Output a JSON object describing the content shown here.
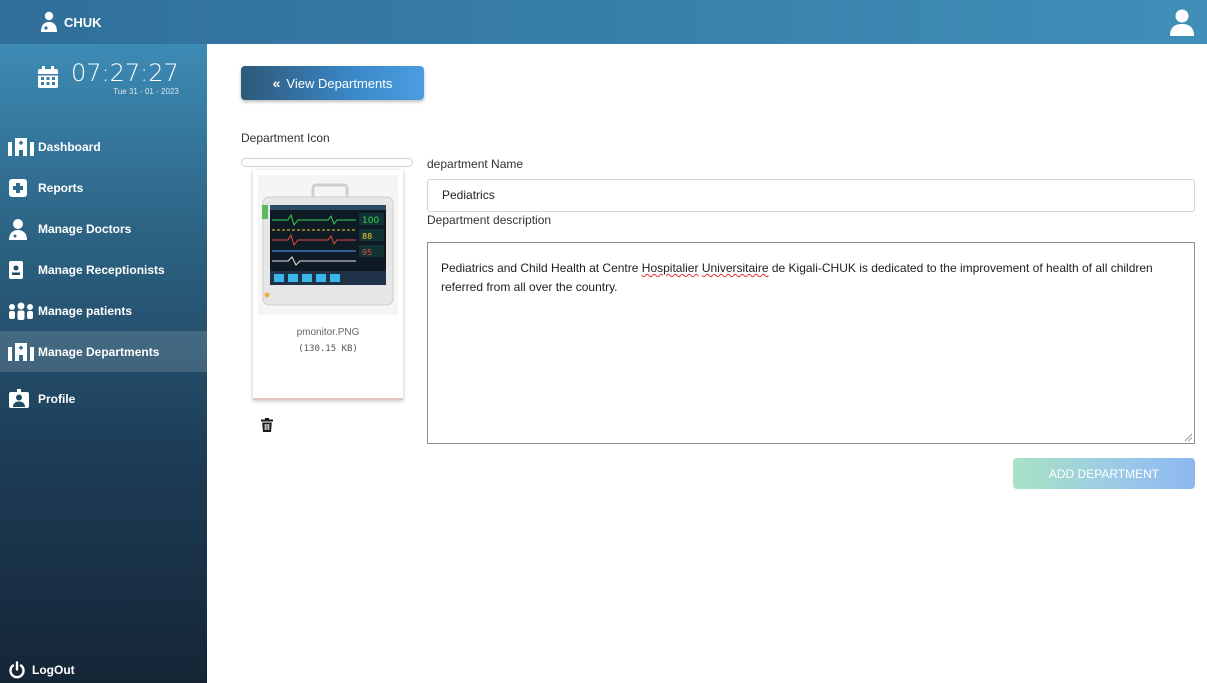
{
  "app": {
    "name": "CHUK"
  },
  "clock": {
    "time": "07:27:27",
    "date": "Tue 31 - 01 - 2023"
  },
  "sidebar": {
    "items": [
      {
        "label": "Dashboard",
        "icon": "hospital-icon"
      },
      {
        "label": "Reports",
        "icon": "medical-report-icon"
      },
      {
        "label": "Manage Doctors",
        "icon": "doctor-icon"
      },
      {
        "label": "Manage Receptionists",
        "icon": "id-badge-icon"
      },
      {
        "label": "Manage patients",
        "icon": "people-icon"
      },
      {
        "label": "Manage Departments",
        "icon": "hospital-icon",
        "active": true
      },
      {
        "label": "Profile",
        "icon": "user-profile-icon"
      }
    ],
    "logout_label": "LogOut"
  },
  "main": {
    "view_button_label": "View Departments",
    "icon_label": "Department Icon",
    "file": {
      "name": "pmonitor.PNG",
      "size": "(130.15 KB)"
    },
    "name_label": "department Name",
    "name_value": "Pediatrics",
    "description_label": "Department description",
    "description": {
      "part1": "Pediatrics and Child Health at Centre ",
      "word_hospitalier": "Hospitalier",
      "space": " ",
      "word_universitaire": "Universitaire",
      "part2": " de Kigali-CHUK is dedicated to the improvement of health of all children referred from all over the country."
    },
    "submit_label": "ADD DEPARTMENT"
  },
  "colors": {
    "topbar": "#3f8fb8",
    "sidebar_top": "#3d8bb5",
    "sidebar_bottom": "#152536",
    "primary_button": "#3a87c7",
    "submit_button": "#9ac9e8"
  }
}
